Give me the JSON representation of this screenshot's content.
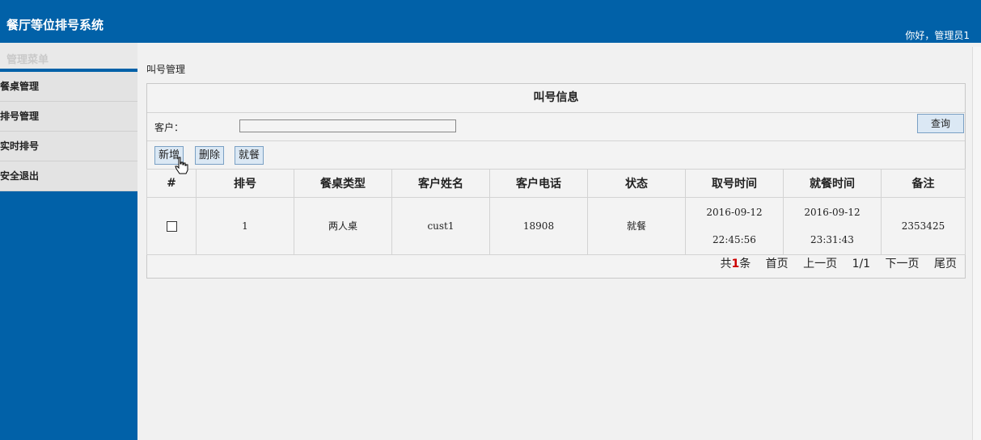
{
  "app": {
    "title": "餐厅等位排号系统",
    "greeting": "你好，管理员1"
  },
  "sidebar": {
    "header": "管理菜单",
    "items": [
      {
        "label": "餐桌管理"
      },
      {
        "label": "排号管理"
      },
      {
        "label": "实时排号"
      },
      {
        "label": "安全退出"
      }
    ]
  },
  "breadcrumb": "叫号管理",
  "panel": {
    "title": "叫号信息",
    "search": {
      "label": "客户：",
      "value": "",
      "button": "查询"
    },
    "toolbar": {
      "add": "新增",
      "delete": "删除",
      "dine": "就餐"
    },
    "columns": [
      "#",
      "排号",
      "餐桌类型",
      "客户姓名",
      "客户电话",
      "状态",
      "取号时间",
      "就餐时间",
      "备注"
    ],
    "rows": [
      {
        "no": "1",
        "table_type": "两人桌",
        "name": "cust1",
        "phone": "18908",
        "status": "就餐",
        "take_date": "2016-09-12",
        "take_time": "22:45:56",
        "dine_date": "2016-09-12",
        "dine_time": "23:31:43",
        "note": "2353425"
      }
    ],
    "pager": {
      "total_prefix": "共",
      "total": "1",
      "total_suffix": "条",
      "first": "首页",
      "prev": "上一页",
      "page": "1/1",
      "next": "下一页",
      "last": "尾页"
    }
  }
}
